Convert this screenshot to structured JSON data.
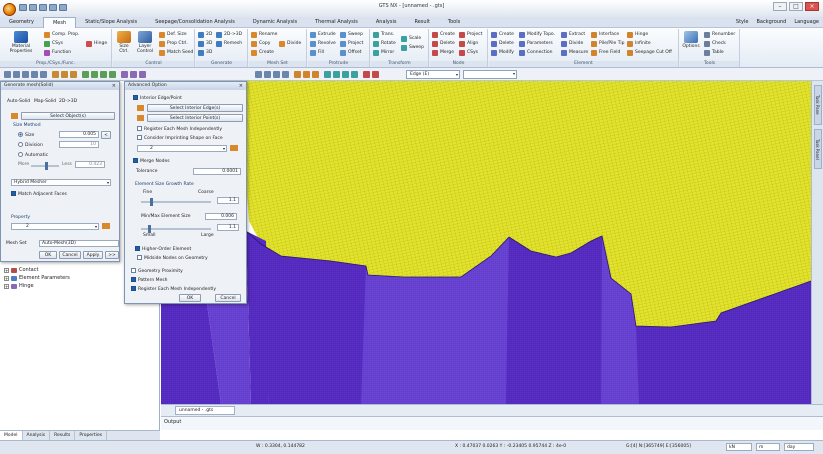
{
  "window": {
    "title": "GTS NX - [unnamed - .gts]"
  },
  "menu": {
    "tabs": [
      "Geometry",
      "Mesh",
      "Static/Slope Analysis",
      "Seepage/Consolidation Analysis",
      "Dynamic Analysis",
      "Thermal Analysis",
      "Analysis",
      "Result",
      "Tools"
    ],
    "active": "Mesh",
    "right": [
      "Style",
      "Background",
      "Language"
    ]
  },
  "ribbon": {
    "groups": {
      "prop": "Prop./CSys./Func.",
      "control": "Control",
      "generate": "Generate",
      "meshset": "Mesh Set",
      "protrude": "Protrude",
      "transform": "Transform",
      "node": "Node",
      "element": "Element",
      "tools": "Tools"
    },
    "items": {
      "material_properties": "Material Properties",
      "comp_prop": "Comp. Prop.",
      "csys": "CSys",
      "function": "Function",
      "hinge": "Hinge",
      "size_ctrl": "Size Ctrl.",
      "layer_control": "Layer Control",
      "def_size": "Def. Size",
      "prop_ctrl": "Prop Ctrl.",
      "match_seed": "Match Seed",
      "auto_2d": "2D",
      "auto_3d": "3D",
      "map_2d": "2D",
      "map_3d": "3D",
      "remesh": "Remesh",
      "2d_3d": "2D->3D",
      "rename": "Rename",
      "copy": "Copy",
      "create_ms": "Create",
      "divide_ms": "Divide",
      "extrude": "Extrude",
      "revolve": "Revolve",
      "fill": "Fill",
      "sweep": "Sweep",
      "project": "Project",
      "offset": "Offset",
      "trans": "Trans.",
      "rotate": "Rotate",
      "mirror": "Mirror",
      "scale": "Scale",
      "sweep_t": "Sweep",
      "create_node": "Create",
      "delete_node": "Delete",
      "merge_node": "Merge",
      "project_node": "Project",
      "align": "Align",
      "csys_node": "CSys",
      "create_el": "Create",
      "delete_el": "Delete",
      "modify_el": "Modify",
      "modify_topo": "Modify Topo.",
      "parameters": "Parameters",
      "connection": "Connection",
      "extract": "Extract",
      "divide_el": "Divide",
      "measure": "Measure",
      "interface": "Interface",
      "pile_tip": "Pile/Pile Tip",
      "free_field": "Free Field",
      "hinge_el": "Hinge",
      "infinite": "Infinite",
      "seepage_cut_off": "Seepage Cut Off",
      "options": "Options",
      "renumber": "Renumber",
      "check": "Check",
      "table": "Table"
    }
  },
  "toolbar": {
    "filter": "Edge (E)",
    "filter2": ""
  },
  "tree": {
    "items": [
      "Contact",
      "Element Parameters",
      "Hinge"
    ]
  },
  "left_tabs": [
    "Model",
    "Analysis",
    "Results",
    "Properties"
  ],
  "generate_dialog": {
    "title": "Generate mesh(Solid)",
    "tabs": [
      "Auto-Solid",
      "Map-Solid",
      "2D->3D"
    ],
    "select_objects": "Select Object(s)",
    "size_method": "Size Method",
    "size_label": "Size",
    "size_value": "0.005",
    "division_label": "Division",
    "division_value": "10",
    "automatic_label": "Automatic",
    "more_label": "More",
    "less_label": "Less",
    "slider_value": "0.423",
    "mesher": "Hybrid Mesher",
    "match_adjacent": "Match Adjacent Faces",
    "property_label": "Property",
    "property_value": "2",
    "mesh_set_label": "Mesh Set",
    "mesh_set_value": "Auto-Mesh(3D)",
    "ok": "OK",
    "cancel": "Cancel",
    "apply": "Apply",
    "more_btn": ">>"
  },
  "advanced_dialog": {
    "title": "Advanced Option",
    "interior_edge_point": "Interior Edge/Point",
    "select_interior_edges": "Select Interior Edge(s)",
    "select_interior_points": "Select Interior Point(s)",
    "register_each": "Register Each Mesh Independently",
    "consider_imprinting": "Consider Imprinting Shape on Face",
    "imprint_value": "2",
    "merge_nodes": "Merge Nodes",
    "tolerance_label": "Tolerance",
    "tolerance_value": "0.0001",
    "growth_rate": "Element Size Growth Rate",
    "fine": "Fine",
    "coarse": "Coarse",
    "growth_value": "1.1",
    "minmax_label": "Min/Max Element Size",
    "minmax_value": "0.006",
    "small": "Small",
    "large": "Large",
    "minmax_ratio": "1.1",
    "higher_order": "Higher-Order Element",
    "midside_nodes": "Midside Nodes on Geometry",
    "geometry_proximity": "Geometry Proximity",
    "pattern_mesh": "Pattern Mesh",
    "register_each2": "Register Each Mesh Independently",
    "ok": "OK",
    "cancel": "Cancel"
  },
  "side_tabs": [
    "Task Pane",
    "Task Panel"
  ],
  "doc_tab": "unnamed - .gts",
  "output_label": "Output",
  "status": {
    "w": "W : 0.3304,  0.144782",
    "coords": "X : 0.47037 0.0263  Y : -0.23405 0.95744  Z : 4e-0",
    "grid": "G:[4] N:[365749] E:[356005]",
    "unit_force": "kN",
    "unit_length": "m",
    "unit_time": "day"
  },
  "colors": {
    "mesh_yellow": "#e6e62e",
    "mesh_purple": "#5b2fc9",
    "ribbon_bg": "#e4ebf4",
    "accent": "#1f5fa8"
  }
}
